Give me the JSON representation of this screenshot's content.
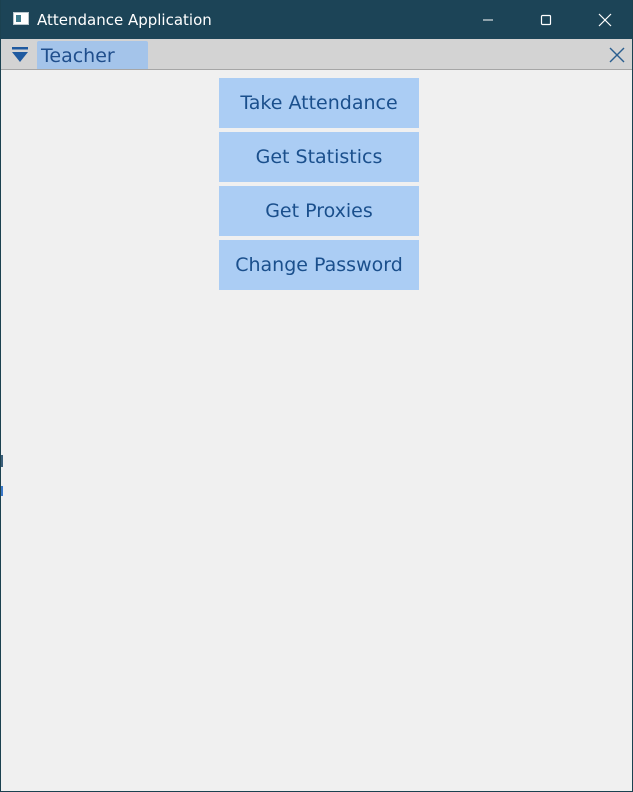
{
  "window": {
    "title": "Attendance Application",
    "icon": "app-window-icon",
    "controls": {
      "minimize_icon": "minimize-icon",
      "maximize_icon": "maximize-icon",
      "close_icon": "close-icon"
    },
    "titlebar_color": "#1c4457"
  },
  "dock": {
    "menu_icon": "dropdown-triangle-icon",
    "tab_label": "Teacher",
    "close_icon": "close-icon",
    "tab_color": "#a4c4ea"
  },
  "main": {
    "buttons": [
      {
        "label": "Take Attendance"
      },
      {
        "label": "Get Statistics"
      },
      {
        "label": "Get Proxies"
      },
      {
        "label": "Change Password"
      }
    ],
    "button_color": "#abcdf4",
    "button_text_color": "#1a4f8c"
  }
}
